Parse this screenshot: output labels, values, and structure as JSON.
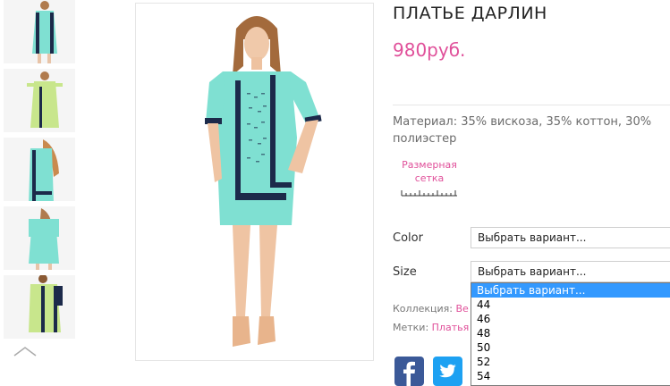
{
  "product": {
    "title": "ПЛАТЬЕ ДАРЛИН",
    "price": "980руб.",
    "material": "Материал: 35% вискоза, 35% коттон, 30% полиэстер",
    "size_chart_label": "Размерная сетка"
  },
  "options": {
    "color": {
      "label": "Color",
      "value": "Выбрать вариант..."
    },
    "size": {
      "label": "Size",
      "value": "Выбрать вариант..."
    }
  },
  "size_dropdown": {
    "items": [
      "Выбрать вариант...",
      "44",
      "46",
      "48",
      "50",
      "52",
      "54"
    ],
    "selected_index": 0
  },
  "meta": {
    "collection_label": "Коллекция:",
    "collection_value": "Ве",
    "tags_label": "Метки:",
    "tags_value": "Платья"
  },
  "social": {
    "facebook_icon": "facebook-icon",
    "twitter_icon": "twitter-icon"
  },
  "colors": {
    "accent": "#e0509a",
    "dress_mint": "#7fe0d2",
    "dress_lime": "#c8e68c",
    "trim_navy": "#1c2a4a"
  }
}
